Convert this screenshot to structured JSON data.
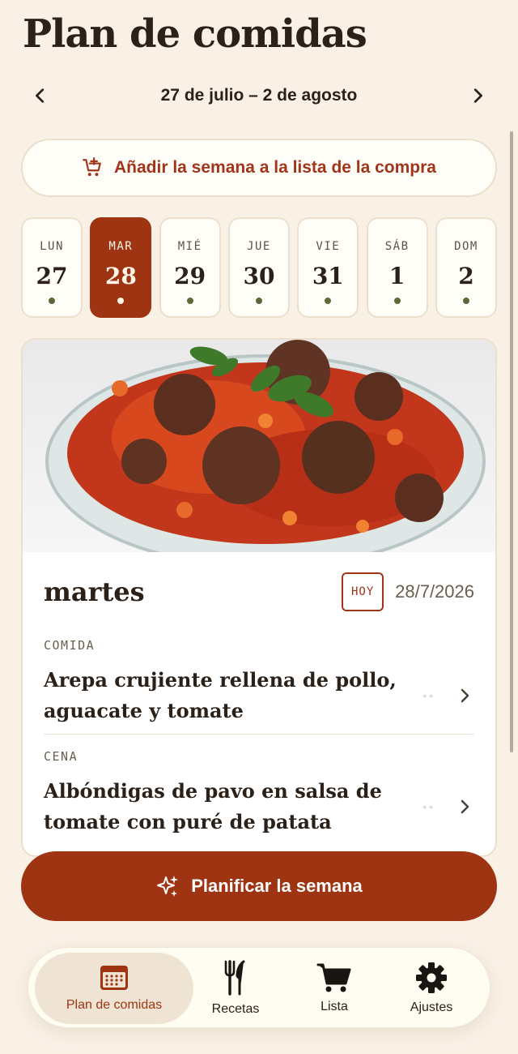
{
  "header": {
    "title": "Plan de comidas"
  },
  "week": {
    "range": "27 de julio – 2 de agosto"
  },
  "add_week_button": {
    "label": "Añadir la semana a la lista de la compra"
  },
  "days": [
    {
      "abbr": "LUN",
      "num": "27"
    },
    {
      "abbr": "MAR",
      "num": "28",
      "selected": true
    },
    {
      "abbr": "MIÉ",
      "num": "29"
    },
    {
      "abbr": "JUE",
      "num": "30"
    },
    {
      "abbr": "VIE",
      "num": "31"
    },
    {
      "abbr": "SÁB",
      "num": "1"
    },
    {
      "abbr": "DOM",
      "num": "2"
    }
  ],
  "day_card": {
    "day_name": "martes",
    "badge": "HOY",
    "date": "28/7/2026",
    "meals": [
      {
        "label": "COMIDA",
        "title": "Arepa crujiente rellena de pollo, aguacate y tomate"
      },
      {
        "label": "CENA",
        "title": "Albóndigas de pavo en salsa de tomate con puré de patata"
      }
    ]
  },
  "plan_button": {
    "label": "Planificar la semana"
  },
  "tabbar": {
    "tabs": [
      {
        "label": "Plan de comidas",
        "icon": "calendar-icon",
        "active": true
      },
      {
        "label": "Recetas",
        "icon": "utensils-icon"
      },
      {
        "label": "Lista",
        "icon": "cart-icon"
      },
      {
        "label": "Ajustes",
        "icon": "gear-icon"
      }
    ]
  },
  "colors": {
    "background": "#f9f1e6",
    "accent": "#9e3412",
    "text": "#2b2118",
    "dot": "#5c6b35"
  }
}
